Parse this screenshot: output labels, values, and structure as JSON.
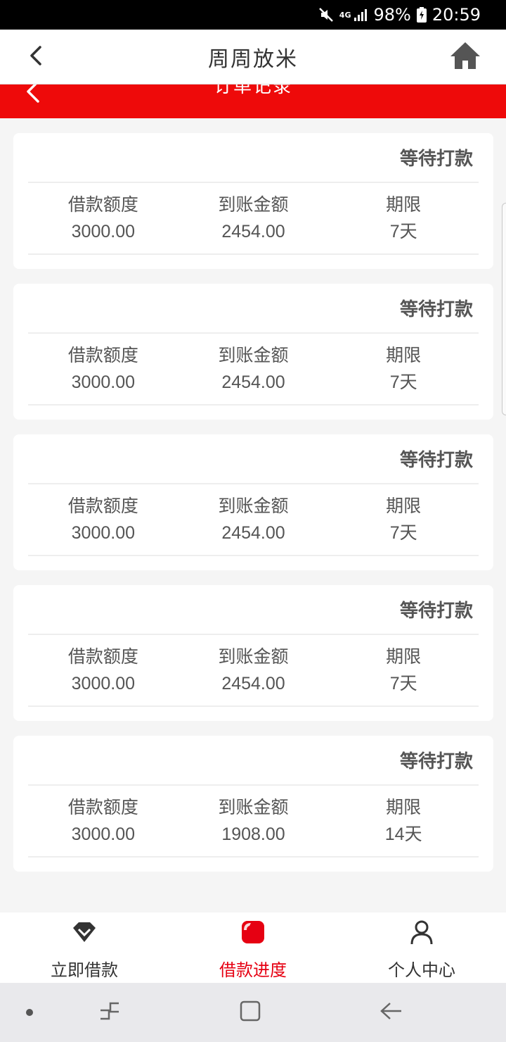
{
  "status_bar": {
    "network": "4G",
    "battery": "98%",
    "time": "20:59"
  },
  "header": {
    "title": "周周放米"
  },
  "sub_header": {
    "title": "订单记录"
  },
  "orders": [
    {
      "status": "等待打款",
      "loan_label": "借款额度",
      "loan_value": "3000.00",
      "received_label": "到账金额",
      "received_value": "2454.00",
      "term_label": "期限",
      "term_value": "7天"
    },
    {
      "status": "等待打款",
      "loan_label": "借款额度",
      "loan_value": "3000.00",
      "received_label": "到账金额",
      "received_value": "2454.00",
      "term_label": "期限",
      "term_value": "7天"
    },
    {
      "status": "等待打款",
      "loan_label": "借款额度",
      "loan_value": "3000.00",
      "received_label": "到账金额",
      "received_value": "2454.00",
      "term_label": "期限",
      "term_value": "7天"
    },
    {
      "status": "等待打款",
      "loan_label": "借款额度",
      "loan_value": "3000.00",
      "received_label": "到账金额",
      "received_value": "2454.00",
      "term_label": "期限",
      "term_value": "7天"
    },
    {
      "status": "等待打款",
      "loan_label": "借款额度",
      "loan_value": "3000.00",
      "received_label": "到账金额",
      "received_value": "1908.00",
      "term_label": "期限",
      "term_value": "14天"
    }
  ],
  "tabs": [
    {
      "label": "立即借款",
      "icon": "diamond-icon",
      "active": false
    },
    {
      "label": "借款进度",
      "icon": "progress-icon",
      "active": true
    },
    {
      "label": "个人中心",
      "icon": "user-icon",
      "active": false
    }
  ],
  "colors": {
    "brand_red": "#ee0a0a",
    "active_tab": "#e60012"
  }
}
